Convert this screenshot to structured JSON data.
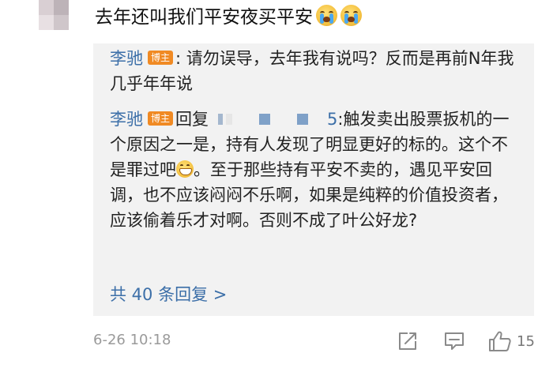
{
  "comment": {
    "text": "去年还叫我们平安夜买平安",
    "emojis": [
      "crying-face-icon",
      "crying-face-icon"
    ]
  },
  "replies": [
    {
      "user": "李驰",
      "badge": "博主",
      "text": ": 请勿误导，去年我有说吗？反而是再前N年我几乎年年说"
    },
    {
      "user": "李驰",
      "badge": "博主",
      "verb": "回复",
      "mention_tail": "5",
      "text_before_emoji": ":触发卖出股票扳机的一个原因之一是，持有人发现了明显更好的标的。这个不是罪过吧",
      "text_after_emoji": "。至于那些持有平安不卖的，遇见平安回调，也不应该闷闷不乐啊，如果是纯粹的价值投资者，应该偷着乐才对啊。否则不成了叶公好龙?"
    }
  ],
  "more_replies": "共 40 条回复 >",
  "footer": {
    "timestamp": "6-26 10:18",
    "like_count": "15"
  },
  "colors": {
    "username": "#3c6fa8",
    "badge": "#f08a24",
    "panel": "#f2f2f2",
    "meta": "#9a9a9a"
  }
}
